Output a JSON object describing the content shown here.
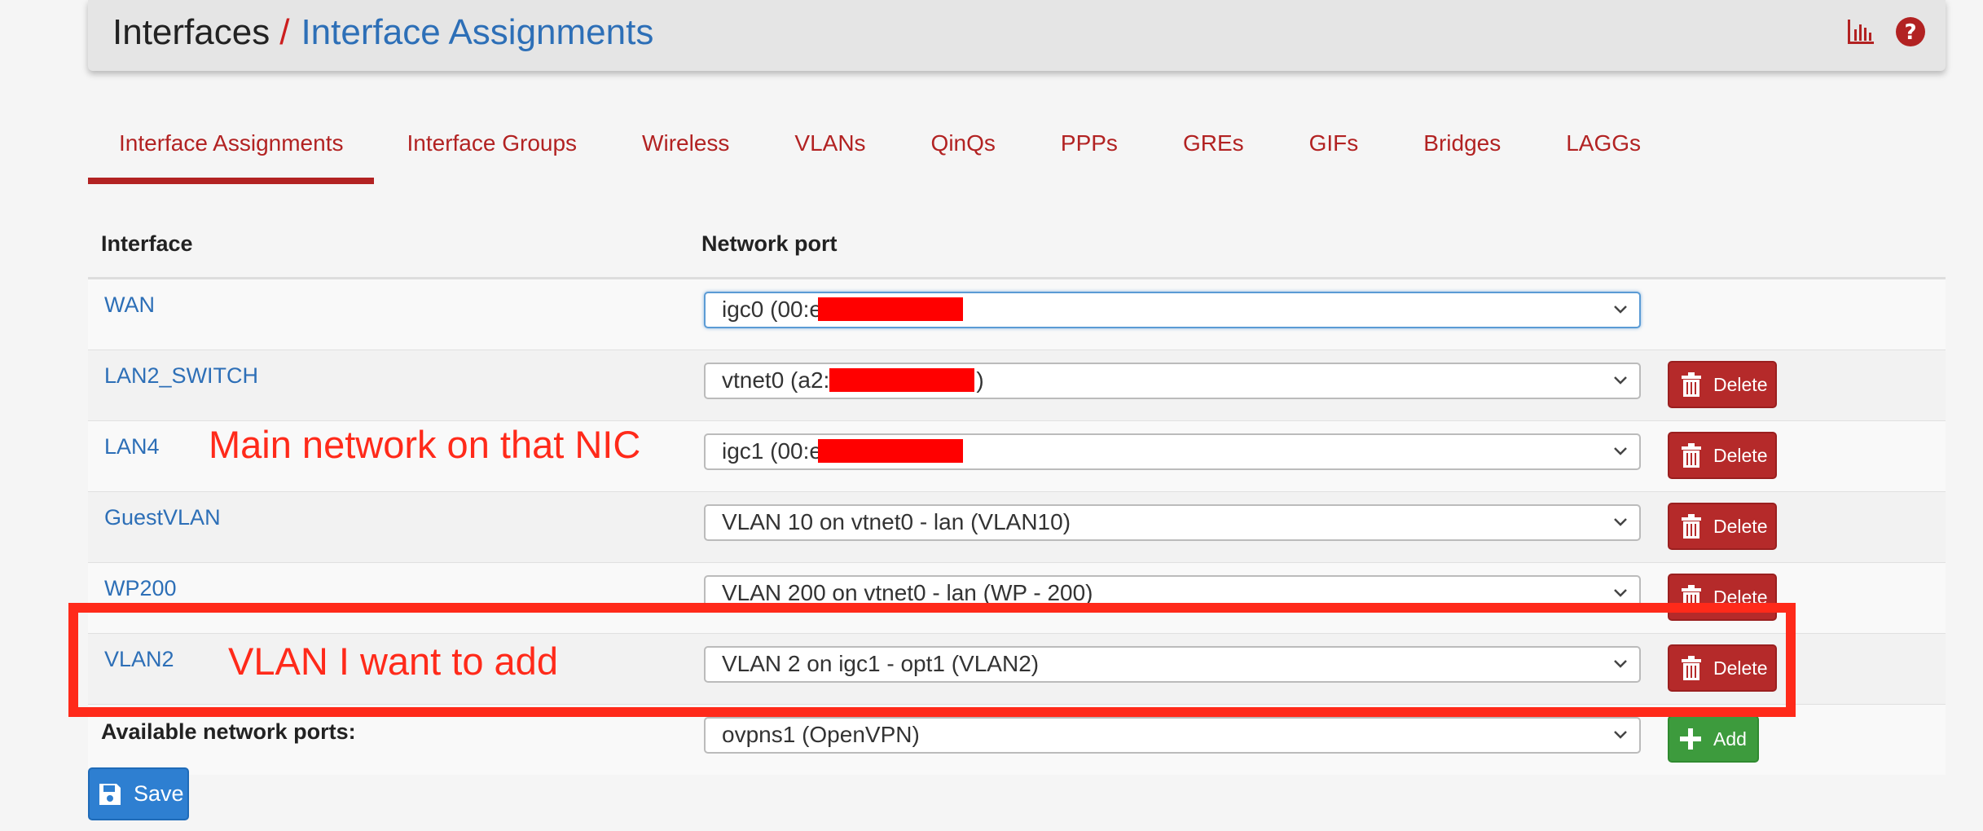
{
  "breadcrumb": {
    "root": "Interfaces",
    "separator": "/",
    "current": "Interface Assignments"
  },
  "header_icons": [
    "chart-icon",
    "help-icon"
  ],
  "tabs": [
    {
      "label": "Interface Assignments",
      "active": true
    },
    {
      "label": "Interface Groups",
      "active": false
    },
    {
      "label": "Wireless",
      "active": false
    },
    {
      "label": "VLANs",
      "active": false
    },
    {
      "label": "QinQs",
      "active": false
    },
    {
      "label": "PPPs",
      "active": false
    },
    {
      "label": "GREs",
      "active": false
    },
    {
      "label": "GIFs",
      "active": false
    },
    {
      "label": "Bridges",
      "active": false
    },
    {
      "label": "LAGGs",
      "active": false
    }
  ],
  "table": {
    "headers": {
      "interface": "Interface",
      "network_port": "Network port"
    },
    "rows": [
      {
        "interface": "WAN",
        "port": "igc0 (00:e",
        "port_suffix": "",
        "delete": false
      },
      {
        "interface": "LAN2_SWITCH",
        "port": "vtnet0 (a2:",
        "port_suffix": ")",
        "delete": true
      },
      {
        "interface": "LAN4",
        "port": "igc1 (00:e",
        "port_suffix": "",
        "delete": true
      },
      {
        "interface": "GuestVLAN",
        "port": "VLAN 10 on vtnet0 - lan (VLAN10)",
        "port_suffix": "",
        "delete": true
      },
      {
        "interface": "WP200",
        "port": "VLAN 200 on vtnet0 - lan (WP - 200)",
        "port_suffix": "",
        "delete": true
      },
      {
        "interface": "VLAN2",
        "port": "VLAN 2 on igc1 - opt1 (VLAN2)",
        "port_suffix": "",
        "delete": true
      }
    ],
    "available": {
      "label": "Available network ports:",
      "port": "ovpns1 (OpenVPN)"
    }
  },
  "buttons": {
    "delete": "Delete",
    "add": "Add",
    "save": "Save"
  },
  "annotations": {
    "main_network": "Main network on that NIC",
    "vlan_add": "VLAN I want to add"
  },
  "colors": {
    "link_blue": "#2d6fb7",
    "tab_red": "#b22222",
    "delete_red": "#b52a2a",
    "add_green": "#3d9b3d",
    "save_blue": "#2e7fd1",
    "annotation_red": "#ff2a1a"
  }
}
